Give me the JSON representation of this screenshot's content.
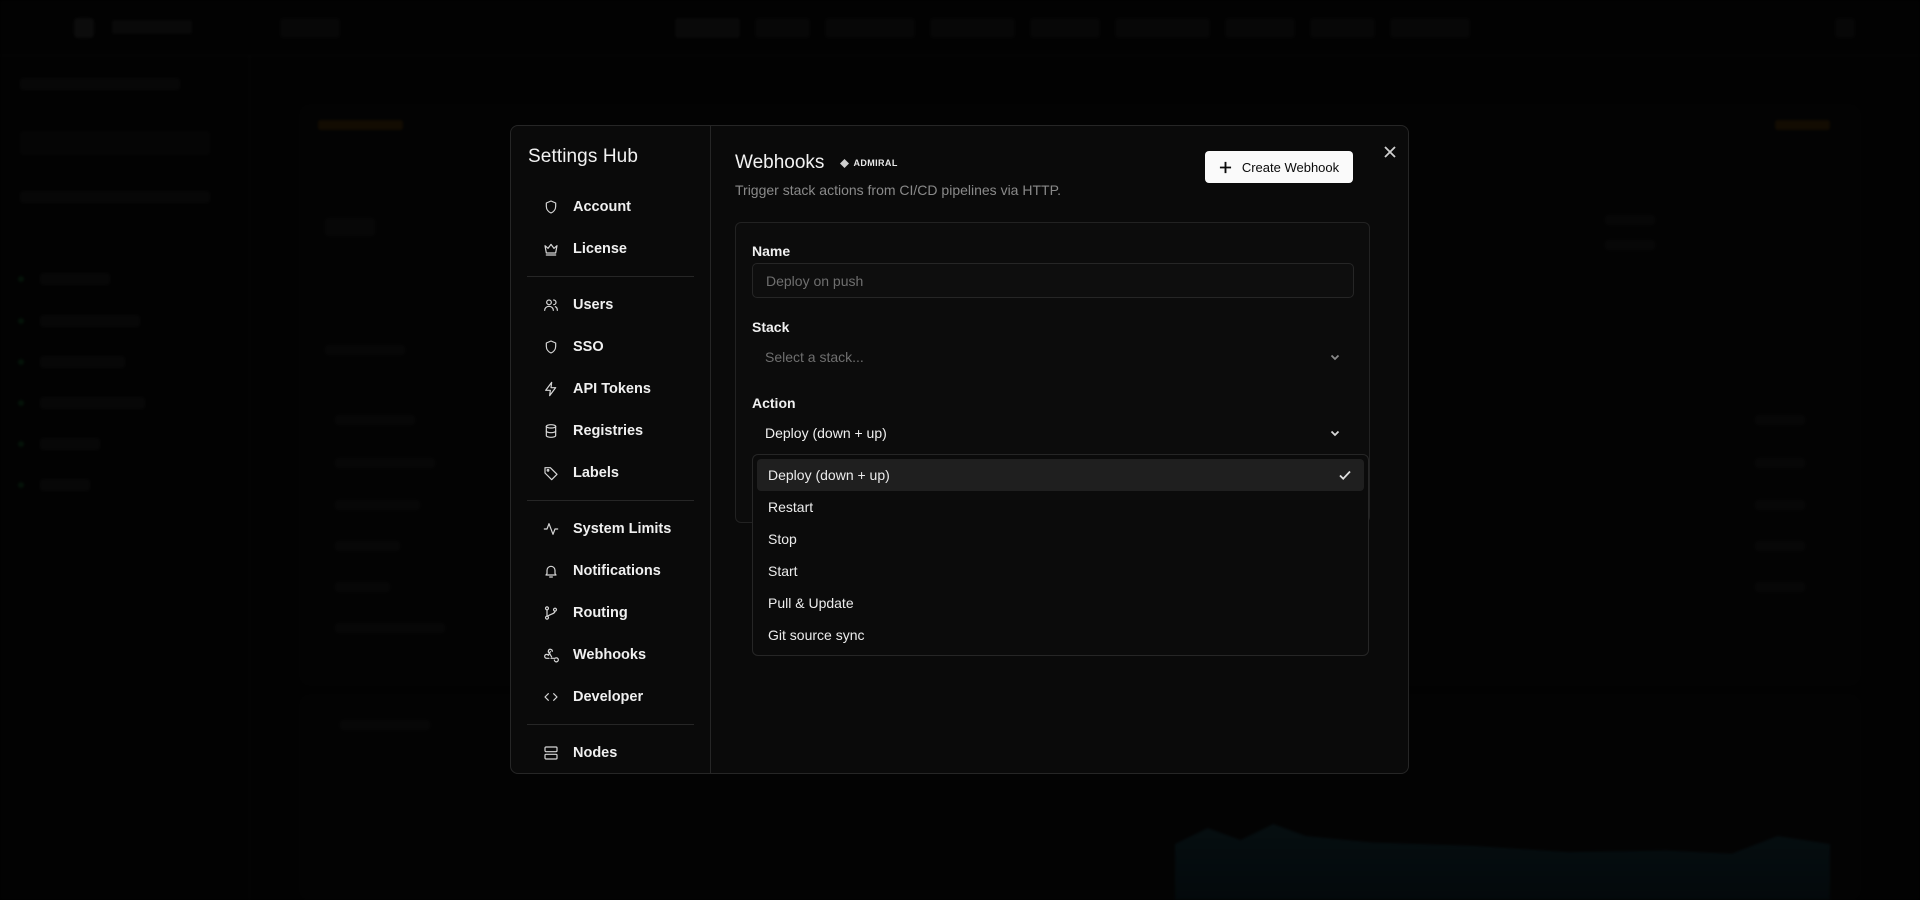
{
  "settings_hub": {
    "title": "Settings Hub",
    "nav_groups": [
      [
        {
          "label": "Account",
          "icon": "shield-icon"
        },
        {
          "label": "License",
          "icon": "crown-icon"
        }
      ],
      [
        {
          "label": "Users",
          "icon": "users-icon"
        },
        {
          "label": "SSO",
          "icon": "shield-icon"
        },
        {
          "label": "API Tokens",
          "icon": "zap-icon"
        },
        {
          "label": "Registries",
          "icon": "database-icon"
        },
        {
          "label": "Labels",
          "icon": "tag-icon"
        }
      ],
      [
        {
          "label": "System Limits",
          "icon": "activity-icon"
        },
        {
          "label": "Notifications",
          "icon": "bell-icon"
        },
        {
          "label": "Routing",
          "icon": "git-branch-icon"
        },
        {
          "label": "Webhooks",
          "icon": "webhook-icon"
        },
        {
          "label": "Developer",
          "icon": "code-icon"
        }
      ],
      [
        {
          "label": "Nodes",
          "icon": "server-icon"
        }
      ]
    ]
  },
  "webhooks": {
    "title": "Webhooks",
    "badge": "ADMIRAL",
    "subtitle": "Trigger stack actions from CI/CD pipelines via HTTP.",
    "create_button": "Create Webhook",
    "form": {
      "name_label": "Name",
      "name_placeholder": "Deploy on push",
      "stack_label": "Stack",
      "stack_placeholder": "Select a stack...",
      "action_label": "Action",
      "action_value": "Deploy (down + up)"
    },
    "action_options": [
      {
        "label": "Deploy (down + up)",
        "selected": true
      },
      {
        "label": "Restart",
        "selected": false
      },
      {
        "label": "Stop",
        "selected": false
      },
      {
        "label": "Start",
        "selected": false
      },
      {
        "label": "Pull & Update",
        "selected": false
      },
      {
        "label": "Git source sync",
        "selected": false
      }
    ]
  }
}
